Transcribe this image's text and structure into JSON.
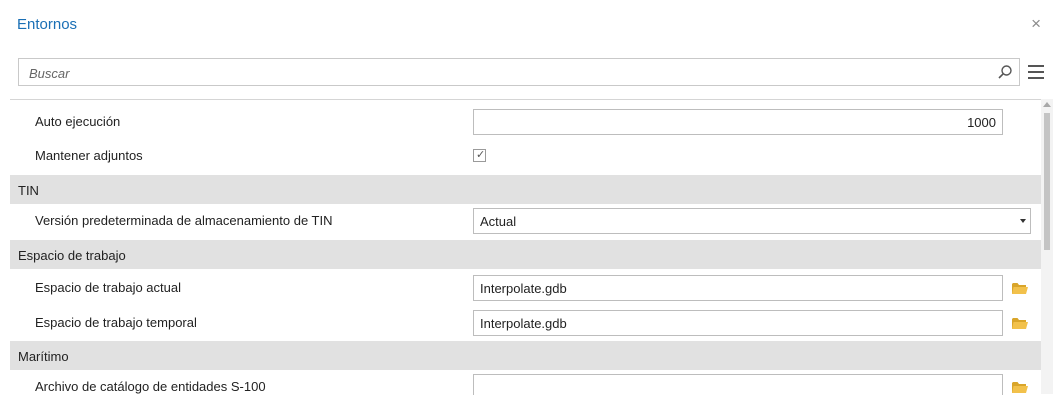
{
  "window": {
    "title": "Entornos",
    "close_glyph": "×"
  },
  "search": {
    "placeholder": "Buscar"
  },
  "icons": {
    "search": "search-icon",
    "menu": "hamburger-menu-icon",
    "folder": "folder-icon",
    "close": "close-icon"
  },
  "colors": {
    "title": "#1a6fb5",
    "category_bg": "#e1e1e1",
    "folder": "#e6b534"
  },
  "settings": {
    "auto_ejecucion": {
      "label": "Auto ejecución",
      "value": "1000"
    },
    "mantener_adjuntos": {
      "label": "Mantener adjuntos",
      "checked": true,
      "check_glyph": "✓"
    },
    "tin": {
      "category": "TIN",
      "version": {
        "label": "Versión predeterminada de almacenamiento de TIN",
        "value": "Actual"
      }
    },
    "espacio_trabajo": {
      "category": "Espacio de trabajo",
      "actual": {
        "label": "Espacio de trabajo actual",
        "value": "Interpolate.gdb"
      },
      "temporal": {
        "label": "Espacio de trabajo temporal",
        "value": "Interpolate.gdb"
      }
    },
    "maritimo": {
      "category": "Marítimo",
      "catalogo": {
        "label": "Archivo de catálogo de entidades S-100",
        "value": ""
      }
    }
  }
}
